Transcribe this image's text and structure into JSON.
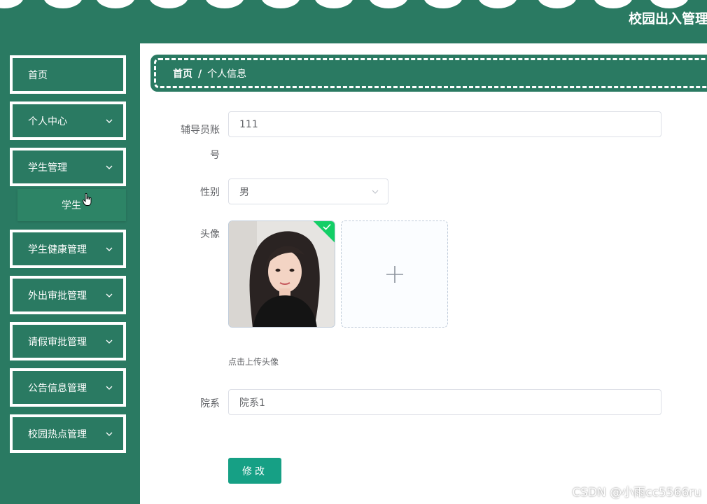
{
  "header": {
    "site_title": "校园出入管理"
  },
  "sidebar": {
    "items": [
      {
        "label": "首页"
      },
      {
        "label": "个人中心"
      },
      {
        "label": "学生管理"
      },
      {
        "label": "学生健康管理"
      },
      {
        "label": "外出审批管理"
      },
      {
        "label": "请假审批管理"
      },
      {
        "label": "公告信息管理"
      },
      {
        "label": "校园热点管理"
      }
    ],
    "submenu": {
      "label": "学生"
    }
  },
  "breadcrumb": {
    "home": "首页",
    "separator": "/",
    "current": "个人信息"
  },
  "form": {
    "account": {
      "label_line1": "辅导员账",
      "label_line2": "号",
      "value": "111"
    },
    "gender": {
      "label": "性别",
      "value": "男"
    },
    "avatar": {
      "label": "头像",
      "tip": "点击上传头像"
    },
    "department": {
      "label": "院系",
      "value": "院系1"
    },
    "submit_label": "修改"
  },
  "watermark": "CSDN @小雨cc5566ru",
  "colors": {
    "primary": "#2a7a62",
    "button": "#16a085",
    "success": "#13ce66"
  },
  "icons": [
    "chevron-down-icon",
    "plus-icon",
    "check-icon",
    "pointer-cursor-icon"
  ]
}
